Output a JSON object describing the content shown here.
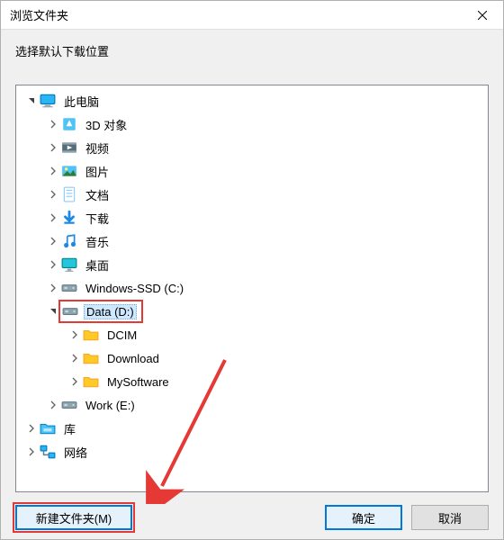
{
  "title": "浏览文件夹",
  "instruction": "选择默认下载位置",
  "tree": [
    {
      "id": "this_pc",
      "label": "此电脑",
      "depth": 0,
      "expanded": true,
      "has_children": true,
      "icon": "monitor",
      "selected": false
    },
    {
      "id": "3d",
      "label": "3D 对象",
      "depth": 1,
      "expanded": false,
      "has_children": true,
      "icon": "3d",
      "selected": false
    },
    {
      "id": "videos",
      "label": "视频",
      "depth": 1,
      "expanded": false,
      "has_children": true,
      "icon": "video",
      "selected": false
    },
    {
      "id": "pictures",
      "label": "图片",
      "depth": 1,
      "expanded": false,
      "has_children": true,
      "icon": "pictures",
      "selected": false
    },
    {
      "id": "documents",
      "label": "文档",
      "depth": 1,
      "expanded": false,
      "has_children": true,
      "icon": "documents",
      "selected": false
    },
    {
      "id": "downloads",
      "label": "下载",
      "depth": 1,
      "expanded": false,
      "has_children": true,
      "icon": "downloads",
      "selected": false
    },
    {
      "id": "music",
      "label": "音乐",
      "depth": 1,
      "expanded": false,
      "has_children": true,
      "icon": "music",
      "selected": false
    },
    {
      "id": "desktop",
      "label": "桌面",
      "depth": 1,
      "expanded": false,
      "has_children": true,
      "icon": "desktop",
      "selected": false
    },
    {
      "id": "drive_c",
      "label": "Windows-SSD (C:)",
      "depth": 1,
      "expanded": false,
      "has_children": true,
      "icon": "drive",
      "selected": false
    },
    {
      "id": "drive_d",
      "label": "Data (D:)",
      "depth": 1,
      "expanded": true,
      "has_children": true,
      "icon": "drive",
      "selected": true,
      "highlight": true
    },
    {
      "id": "dcim",
      "label": "DCIM",
      "depth": 2,
      "expanded": false,
      "has_children": true,
      "icon": "folder",
      "selected": false
    },
    {
      "id": "download_folder",
      "label": "Download",
      "depth": 2,
      "expanded": false,
      "has_children": true,
      "icon": "folder",
      "selected": false
    },
    {
      "id": "mysoftware",
      "label": "MySoftware",
      "depth": 2,
      "expanded": false,
      "has_children": true,
      "icon": "folder",
      "selected": false
    },
    {
      "id": "drive_e",
      "label": "Work (E:)",
      "depth": 1,
      "expanded": false,
      "has_children": true,
      "icon": "drive",
      "selected": false
    },
    {
      "id": "libraries",
      "label": "库",
      "depth": 0,
      "expanded": false,
      "has_children": true,
      "icon": "libraries",
      "selected": false
    },
    {
      "id": "network",
      "label": "网络",
      "depth": 0,
      "expanded": false,
      "has_children": true,
      "icon": "network",
      "selected": false
    }
  ],
  "buttons": {
    "new_folder": "新建文件夹(M)",
    "ok": "确定",
    "cancel": "取消"
  }
}
